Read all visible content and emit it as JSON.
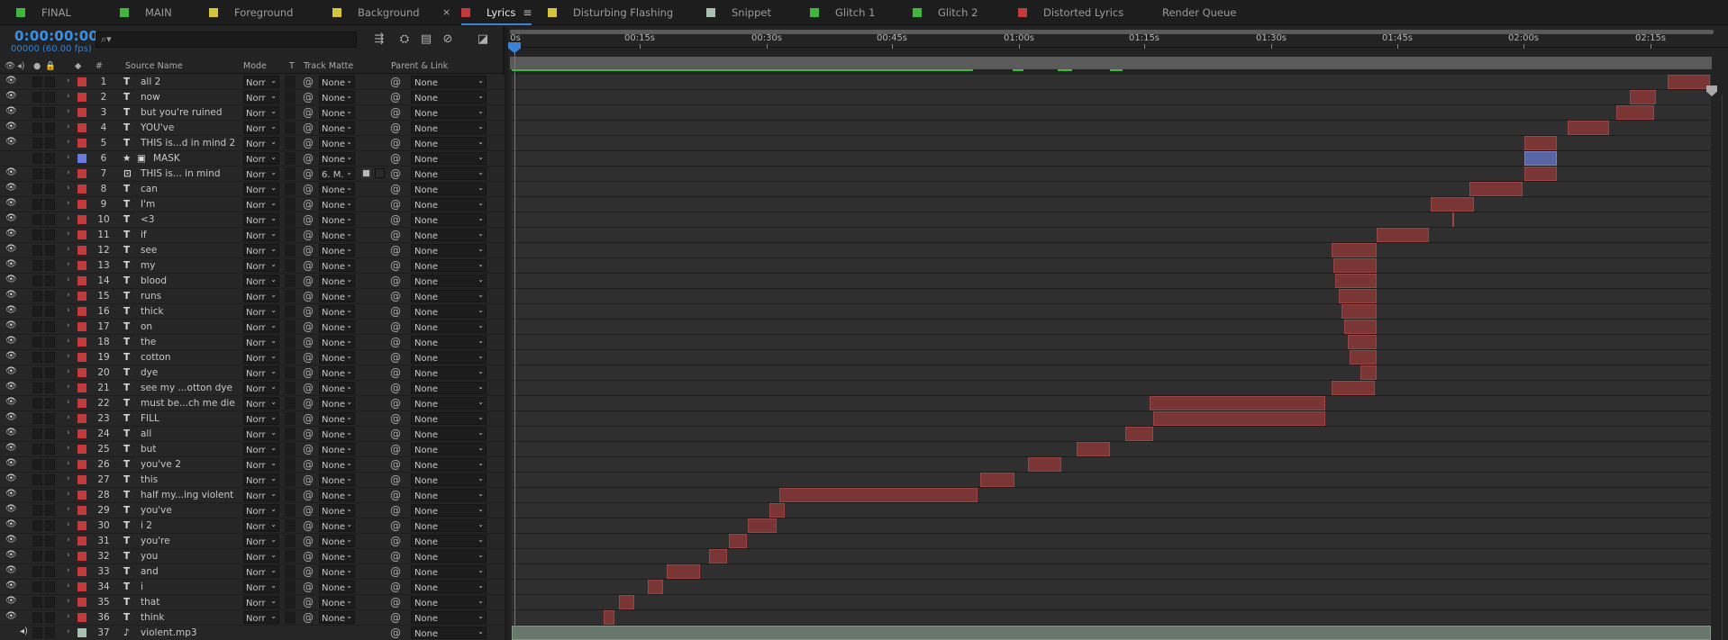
{
  "tabs": [
    {
      "label": "FINAL",
      "color": "#3db83d"
    },
    {
      "label": "MAIN",
      "color": "#3db83d"
    },
    {
      "label": "Foreground",
      "color": "#d6c43a"
    },
    {
      "label": "Background",
      "color": "#d6c43a"
    },
    {
      "label": "Lyrics",
      "color": "#c43a3a",
      "active": true
    },
    {
      "label": "Disturbing Flashing",
      "color": "#d6c43a"
    },
    {
      "label": "Snippet",
      "color": "#a8c0b0"
    },
    {
      "label": "Glitch 1",
      "color": "#3db83d"
    },
    {
      "label": "Glitch 2",
      "color": "#3db83d"
    },
    {
      "label": "Distorted Lyrics",
      "color": "#c43a3a"
    },
    {
      "label": "Render Queue",
      "color": ""
    }
  ],
  "timecode": "0:00:00:00",
  "frames": "00000 (60.00 fps)",
  "search_placeholder": "",
  "columns": {
    "source_name": "Source Name",
    "mode": "Mode",
    "t": "T",
    "track_matte": "Track Matte",
    "parent_link": "Parent & Link",
    "hash": "#"
  },
  "ruler": [
    "0s",
    "00:15s",
    "00:30s",
    "00:45s",
    "01:00s",
    "01:15s",
    "01:30s",
    "01:45s",
    "02:00s",
    "02:15s"
  ],
  "layers": [
    {
      "n": "1",
      "name": "all 2",
      "type": "T",
      "mode": "Norr",
      "matte": "None",
      "parent": "None",
      "color": "#c43a3a"
    },
    {
      "n": "2",
      "name": "now",
      "type": "T",
      "mode": "Norr",
      "matte": "None",
      "parent": "None",
      "color": "#c43a3a"
    },
    {
      "n": "3",
      "name": "but you're ruined",
      "type": "T",
      "mode": "Norr",
      "matte": "None",
      "parent": "None",
      "color": "#c43a3a"
    },
    {
      "n": "4",
      "name": "YOU've",
      "type": "T",
      "mode": "Norr",
      "matte": "None",
      "parent": "None",
      "color": "#c43a3a"
    },
    {
      "n": "5",
      "name": "THIS is...d in mind 2",
      "type": "T",
      "mode": "Norr",
      "matte": "None",
      "parent": "None",
      "color": "#c43a3a"
    },
    {
      "n": "6",
      "name": "MASK",
      "type": "S",
      "mode": "Norr",
      "matte": "None",
      "parent": "None",
      "color": "#6a7ae0"
    },
    {
      "n": "7",
      "name": "THIS is... in mind",
      "type": "M",
      "mode": "Norr",
      "matte": "6. M.",
      "parent": "None",
      "color": "#c43a3a"
    },
    {
      "n": "8",
      "name": "can",
      "type": "T",
      "mode": "Norr",
      "matte": "None",
      "parent": "None",
      "color": "#c43a3a"
    },
    {
      "n": "9",
      "name": "I'm",
      "type": "T",
      "mode": "Norr",
      "matte": "None",
      "parent": "None",
      "color": "#c43a3a"
    },
    {
      "n": "10",
      "name": "<3",
      "type": "T",
      "mode": "Norr",
      "matte": "None",
      "parent": "None",
      "color": "#c43a3a"
    },
    {
      "n": "11",
      "name": "if",
      "type": "T",
      "mode": "Norr",
      "matte": "None",
      "parent": "None",
      "color": "#c43a3a"
    },
    {
      "n": "12",
      "name": "see",
      "type": "T",
      "mode": "Norr",
      "matte": "None",
      "parent": "None",
      "color": "#c43a3a"
    },
    {
      "n": "13",
      "name": "my",
      "type": "T",
      "mode": "Norr",
      "matte": "None",
      "parent": "None",
      "color": "#c43a3a"
    },
    {
      "n": "14",
      "name": "blood",
      "type": "T",
      "mode": "Norr",
      "matte": "None",
      "parent": "None",
      "color": "#c43a3a"
    },
    {
      "n": "15",
      "name": "runs",
      "type": "T",
      "mode": "Norr",
      "matte": "None",
      "parent": "None",
      "color": "#c43a3a"
    },
    {
      "n": "16",
      "name": "thick",
      "type": "T",
      "mode": "Norr",
      "matte": "None",
      "parent": "None",
      "color": "#c43a3a"
    },
    {
      "n": "17",
      "name": "on",
      "type": "T",
      "mode": "Norr",
      "matte": "None",
      "parent": "None",
      "color": "#c43a3a"
    },
    {
      "n": "18",
      "name": "the",
      "type": "T",
      "mode": "Norr",
      "matte": "None",
      "parent": "None",
      "color": "#c43a3a"
    },
    {
      "n": "19",
      "name": "cotton",
      "type": "T",
      "mode": "Norr",
      "matte": "None",
      "parent": "None",
      "color": "#c43a3a"
    },
    {
      "n": "20",
      "name": "dye",
      "type": "T",
      "mode": "Norr",
      "matte": "None",
      "parent": "None",
      "color": "#c43a3a"
    },
    {
      "n": "21",
      "name": "see my ...otton dye",
      "type": "T",
      "mode": "Norr",
      "matte": "None",
      "parent": "None",
      "color": "#c43a3a"
    },
    {
      "n": "22",
      "name": "must be...ch me die",
      "type": "T",
      "mode": "Norr",
      "matte": "None",
      "parent": "None",
      "color": "#c43a3a"
    },
    {
      "n": "23",
      "name": "FILL",
      "type": "T",
      "mode": "Norr",
      "matte": "None",
      "parent": "None",
      "color": "#c43a3a"
    },
    {
      "n": "24",
      "name": "all",
      "type": "T",
      "mode": "Norr",
      "matte": "None",
      "parent": "None",
      "color": "#c43a3a"
    },
    {
      "n": "25",
      "name": "but",
      "type": "T",
      "mode": "Norr",
      "matte": "None",
      "parent": "None",
      "color": "#c43a3a"
    },
    {
      "n": "26",
      "name": "you've 2",
      "type": "T",
      "mode": "Norr",
      "matte": "None",
      "parent": "None",
      "color": "#c43a3a"
    },
    {
      "n": "27",
      "name": "this",
      "type": "T",
      "mode": "Norr",
      "matte": "None",
      "parent": "None",
      "color": "#c43a3a"
    },
    {
      "n": "28",
      "name": "half my...ing violent",
      "type": "T",
      "mode": "Norr",
      "matte": "None",
      "parent": "None",
      "color": "#c43a3a"
    },
    {
      "n": "29",
      "name": "you've",
      "type": "T",
      "mode": "Norr",
      "matte": "None",
      "parent": "None",
      "color": "#c43a3a"
    },
    {
      "n": "30",
      "name": "i 2",
      "type": "T",
      "mode": "Norr",
      "matte": "None",
      "parent": "None",
      "color": "#c43a3a"
    },
    {
      "n": "31",
      "name": "you're",
      "type": "T",
      "mode": "Norr",
      "matte": "None",
      "parent": "None",
      "color": "#c43a3a"
    },
    {
      "n": "32",
      "name": "you",
      "type": "T",
      "mode": "Norr",
      "matte": "None",
      "parent": "None",
      "color": "#c43a3a"
    },
    {
      "n": "33",
      "name": "and",
      "type": "T",
      "mode": "Norr",
      "matte": "None",
      "parent": "None",
      "color": "#c43a3a"
    },
    {
      "n": "34",
      "name": "i",
      "type": "T",
      "mode": "Norr",
      "matte": "None",
      "parent": "None",
      "color": "#c43a3a"
    },
    {
      "n": "35",
      "name": "that",
      "type": "T",
      "mode": "Norr",
      "matte": "None",
      "parent": "None",
      "color": "#c43a3a"
    },
    {
      "n": "36",
      "name": "think",
      "type": "T",
      "mode": "Norr",
      "matte": "None",
      "parent": "None",
      "color": "#c43a3a"
    },
    {
      "n": "37",
      "name": "violent.mp3",
      "type": "A",
      "mode": "",
      "matte": "",
      "parent": "None",
      "color": "#a8c0b0"
    }
  ]
}
